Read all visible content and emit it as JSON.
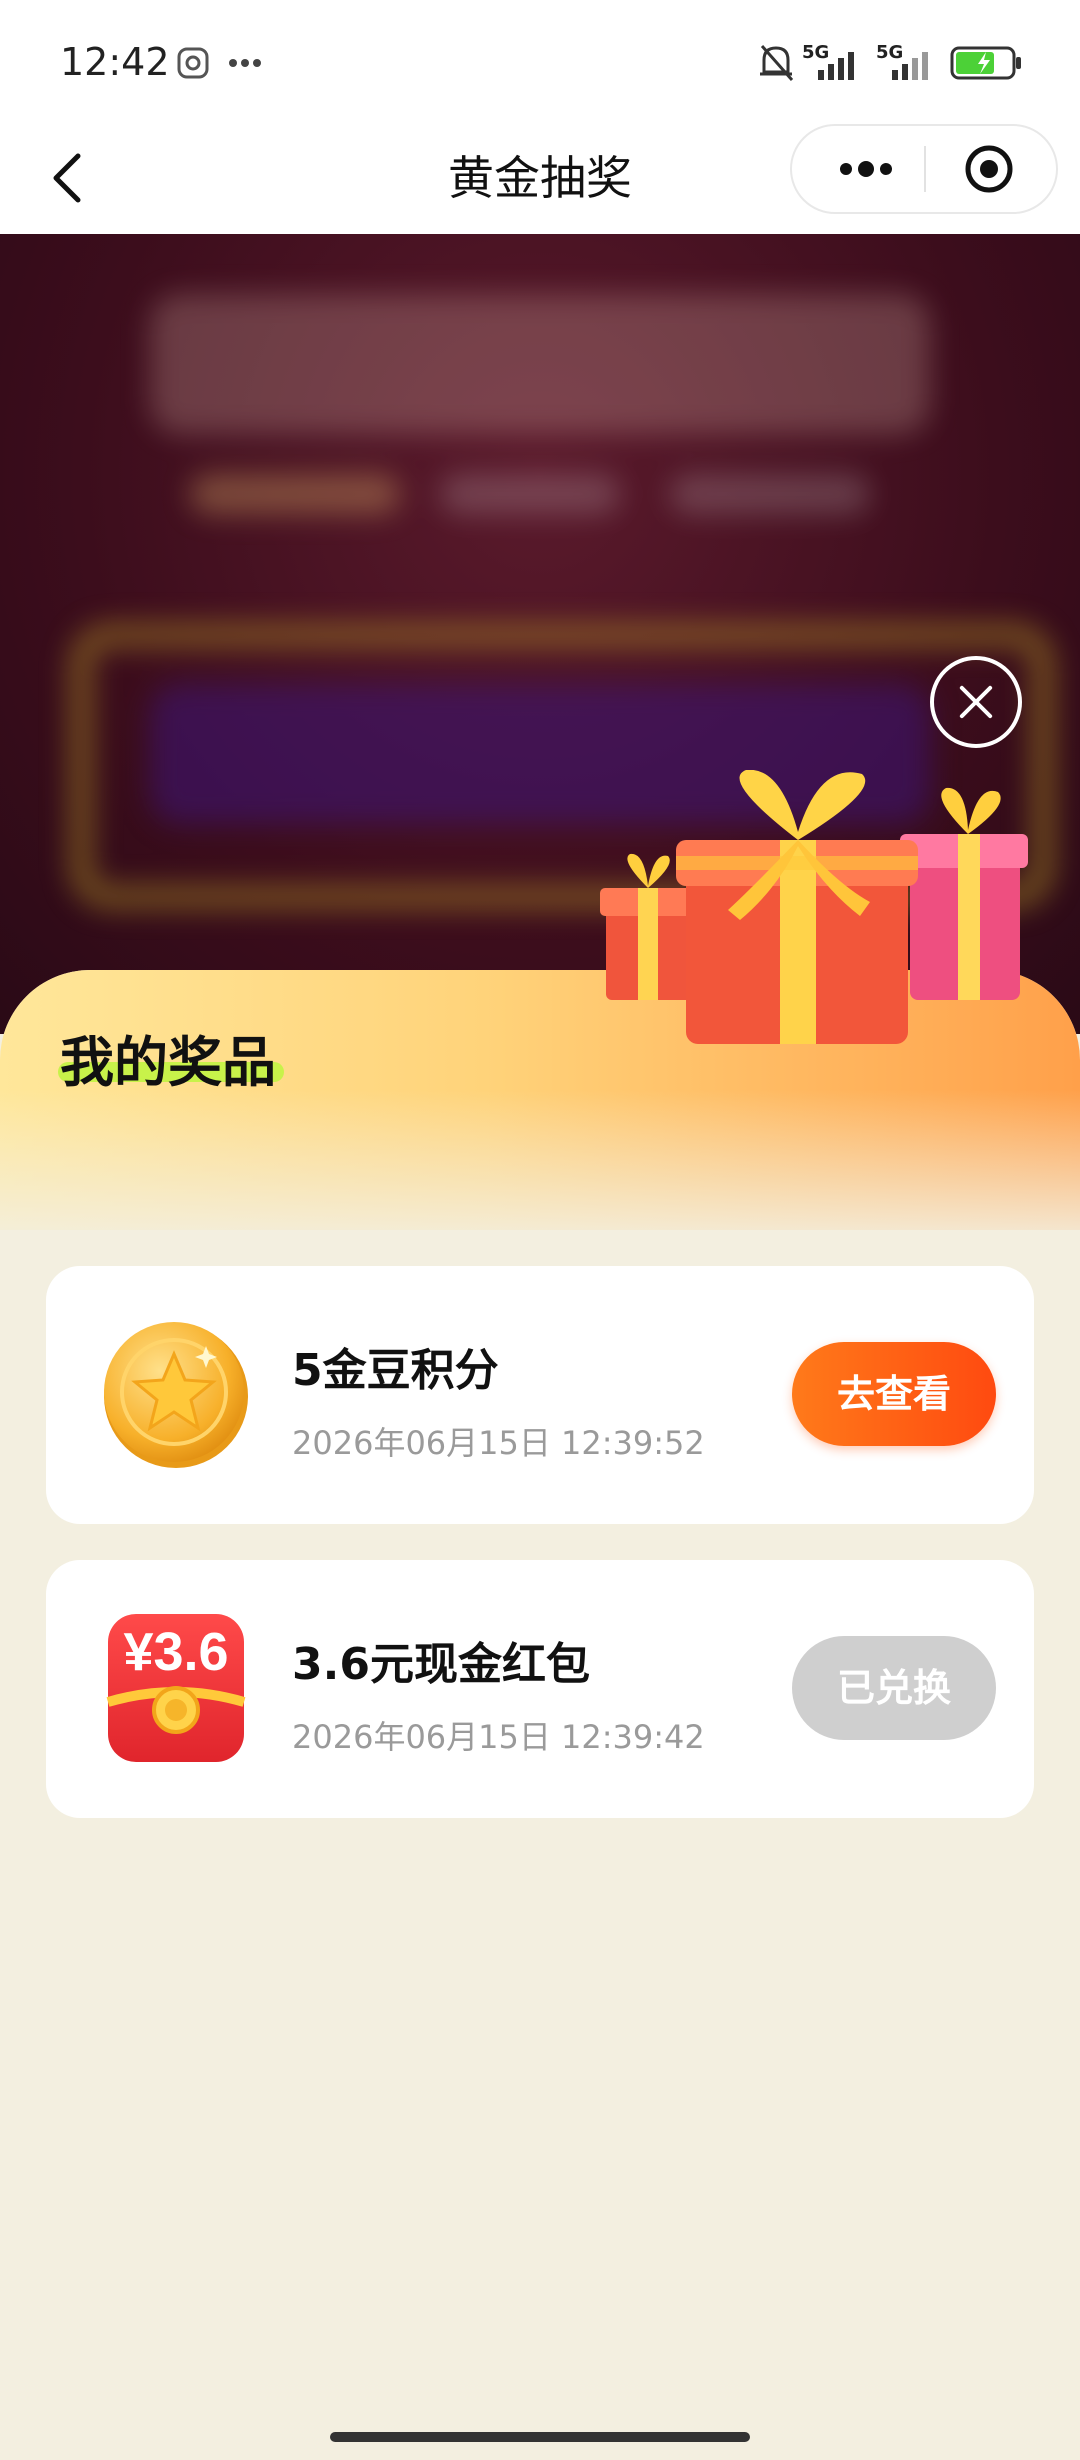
{
  "status_bar": {
    "time": "12:42",
    "icons": [
      "sim-icon",
      "more-dots-icon",
      "mute-bell-icon",
      "signal-5g-icon",
      "signal-5g-icon",
      "battery-charging-icon"
    ],
    "network_label_1": "5G",
    "network_label_2": "5G"
  },
  "nav": {
    "title": "黄金抽奖",
    "back_icon": "chevron-left-icon",
    "more_icon": "more-dots-icon",
    "target_icon": "target-icon"
  },
  "sheet": {
    "title": "我的奖品",
    "close_icon": "close-icon"
  },
  "prizes": [
    {
      "name": "5金豆积分",
      "time": "2026年06月15日 12:39:52",
      "button": "去查看",
      "icon": "gold-coin-star-icon",
      "status": "active"
    },
    {
      "name": "3.6元现金红包",
      "time": "2026年06月15日 12:39:42",
      "button": "已兑换",
      "icon": "red-envelope-icon",
      "badge": "¥3.6",
      "status": "redeemed"
    }
  ],
  "colors": {
    "accent": "#ff5a14",
    "disabled": "#cfcfcf",
    "sheet_bg": "#f3efe0",
    "title_highlight": "#c8f24a"
  }
}
